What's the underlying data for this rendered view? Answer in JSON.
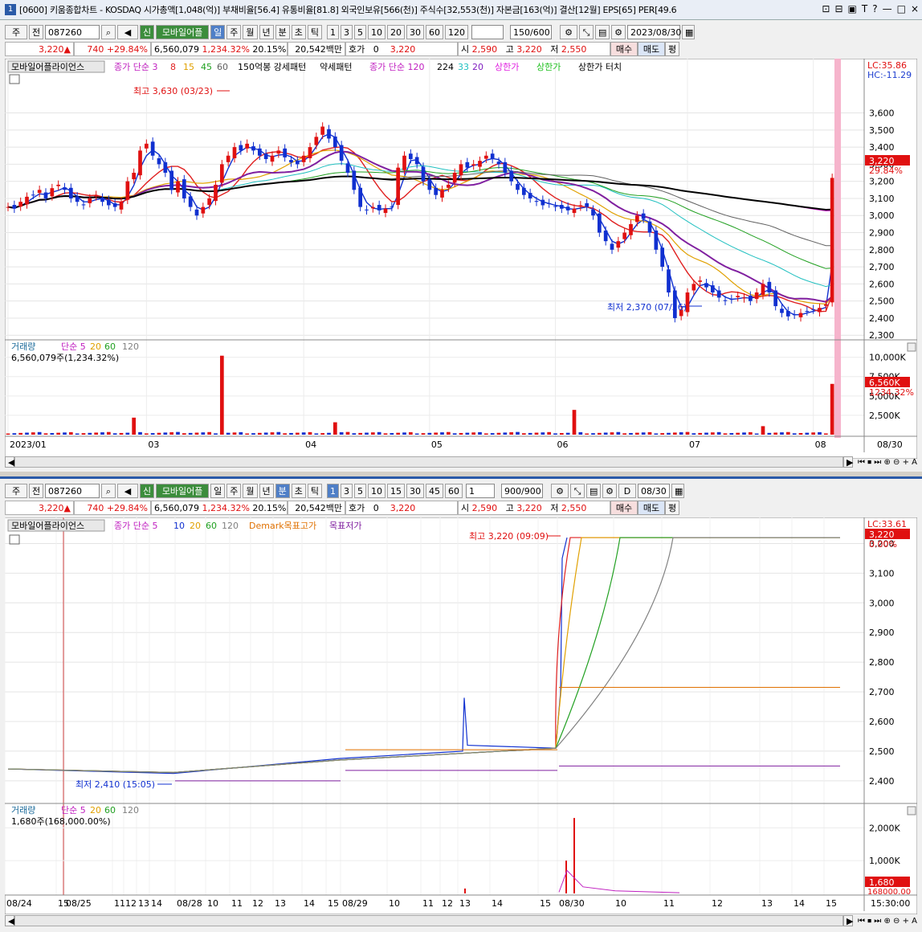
{
  "window": {
    "num": "1",
    "title": "[0600] 키움종합차트 - KOSDAQ 시가총액[1,048(억)] 부채비율[56.4] 유통비율[81.8] 외국인보유[566(천)] 주식수[32,553(천)] 자본금[163(억)] 결산[12월] EPS[65] PER[49.6",
    "controls": [
      "⊡",
      "⊟",
      "▣",
      "T",
      "?",
      "—",
      "□",
      "×"
    ]
  },
  "top": {
    "toolbar": {
      "market": "주",
      "prev": "전",
      "code": "087260",
      "name_badge": "신",
      "name": "모바일어플",
      "periods": [
        "일",
        "주",
        "월",
        "년",
        "분",
        "초",
        "틱"
      ],
      "selected_period": "일",
      "nums": [
        "1",
        "3",
        "5",
        "10",
        "20",
        "30",
        "60",
        "120"
      ],
      "count": "150",
      "count_total": "/600",
      "date": "2023/08/30"
    },
    "quote": {
      "price": "3,220",
      "arrow": "▲",
      "change": "740",
      "pct": "+29.84%",
      "volume": "6,560,079",
      "vol_pct": "1,234.32%",
      "turnover": "20.15%",
      "amount": "20,542백만",
      "hoga_label": "호가",
      "hoga_val": "0",
      "hoga_price": "3,220",
      "open_label": "시",
      "open": "2,590",
      "high_label": "고",
      "high": "3,220",
      "low_label": "저",
      "low": "2,550",
      "buy": "매수",
      "sell": "매도",
      "flat": "평"
    },
    "legend": {
      "name": "모바일어플라이언스",
      "ma_label": "종가 단순 3",
      "ma_periods": [
        "8",
        "15",
        "45",
        "60"
      ],
      "ind1": "150억봉 강세패턴",
      "ind2": "약세패턴",
      "ma2_label": "종가 단순 120",
      "ma2_periods": [
        "224",
        "33",
        "20"
      ],
      "upper1": "상한가",
      "upper2": "상한가",
      "upper3": "상한가 터치"
    },
    "lc": "LC:35.86",
    "hc": "HC:-11.29",
    "price_tag": "3,220",
    "price_tag_pct": "29.84%",
    "high_note": "최고 3,630 (03/23)",
    "low_note": "최저 2,370 (07/26)",
    "vol_legend_name": "거래량",
    "vol_legend_ma": "단순 5",
    "vol_legend_p": [
      "20",
      "60",
      "120"
    ],
    "vol_text": "6,560,079주(1,234.32%)",
    "vol_tag": "6,560K",
    "vol_tag_pct": "1234.32%",
    "x_labels": [
      "2023/01",
      "03",
      "04",
      "05",
      "06",
      "07",
      "08"
    ],
    "x_right": "08/30"
  },
  "bottom": {
    "toolbar": {
      "market": "주",
      "prev": "전",
      "code": "087260",
      "name_badge": "신",
      "name": "모바일어플",
      "periods": [
        "일",
        "주",
        "월",
        "년",
        "분",
        "초",
        "틱"
      ],
      "selected_period": "분",
      "nums": [
        "1",
        "3",
        "5",
        "10",
        "15",
        "30",
        "45",
        "60"
      ],
      "sel_num": "1",
      "count": "900",
      "count_total": "/900",
      "date": "08/30",
      "d_label": "D"
    },
    "quote": {
      "price": "3,220",
      "arrow": "▲",
      "change": "740",
      "pct": "+29.84%",
      "volume": "6,560,079",
      "vol_pct": "1,234.32%",
      "turnover": "20.15%",
      "amount": "20,542백만",
      "hoga_label": "호가",
      "hoga_val": "0",
      "hoga_price": "3,220",
      "open_label": "시",
      "open": "2,590",
      "high_label": "고",
      "high": "3,220",
      "low_label": "저",
      "low": "2,550",
      "buy": "매수",
      "sell": "매도",
      "flat": "평"
    },
    "legend": {
      "name": "모바일어플라이언스",
      "ma_label": "종가 단순 5",
      "ma_periods": [
        "10",
        "20",
        "60",
        "120"
      ],
      "demark_hi": "Demark목표고가",
      "demark_lo": "목표저가"
    },
    "lc": "LC:33.61",
    "price_tag": "3,220",
    "price_tag_pct": "0.00%",
    "high_note": "최고 3,220 (09:09)",
    "low_note": "최저 2,410 (15:05)",
    "vol_legend_name": "거래량",
    "vol_legend_ma": "단순 5",
    "vol_legend_p": [
      "20",
      "60",
      "120"
    ],
    "vol_text": "1,680주(168,000.00%)",
    "vol_tag": "1,680",
    "vol_tag_pct": "168000.00",
    "x_labels": [
      "08/24",
      "15",
      "08/25",
      "11",
      "12",
      "13",
      "14",
      "08/28",
      "10",
      "11",
      "12",
      "13",
      "14",
      "15",
      "08/29",
      "10",
      "11",
      "12",
      "13",
      "14",
      "15",
      "08/30",
      "10",
      "11",
      "12",
      "13",
      "14",
      "15"
    ],
    "x_right": "15:30:00"
  },
  "chart_data": [
    {
      "type": "candlestick",
      "title": "모바일어플라이언스 일봉",
      "y_ticks": [
        2300,
        2400,
        2500,
        2600,
        2700,
        2800,
        2900,
        3000,
        3100,
        3200,
        3300,
        3400,
        3500,
        3600
      ],
      "ylim": [
        2240,
        3720
      ],
      "x_months": [
        "2023/01",
        "03",
        "04",
        "05",
        "06",
        "07",
        "08"
      ],
      "close_series": [
        3050,
        3040,
        3080,
        3110,
        3120,
        3150,
        3100,
        3160,
        3180,
        3150,
        3100,
        3080,
        3060,
        3100,
        3120,
        3080,
        3060,
        3050,
        3080,
        3200,
        3250,
        3380,
        3420,
        3350,
        3300,
        3250,
        3150,
        3200,
        3100,
        3050,
        3000,
        3050,
        3100,
        3180,
        3300,
        3350,
        3400,
        3380,
        3420,
        3380,
        3350,
        3330,
        3350,
        3380,
        3340,
        3310,
        3300,
        3350,
        3400,
        3460,
        3520,
        3450,
        3400,
        3320,
        3250,
        3150,
        3050,
        3030,
        3050,
        3030,
        3040,
        3050,
        3280,
        3350,
        3330,
        3300,
        3200,
        3150,
        3120,
        3150,
        3180,
        3250,
        3300,
        3280,
        3300,
        3320,
        3350,
        3330,
        3300,
        3250,
        3200,
        3150,
        3120,
        3100,
        3080,
        3060,
        3070,
        3050,
        3040,
        3030,
        3040,
        3060,
        3050,
        3000,
        2900,
        2850,
        2800,
        2850,
        2900,
        2950,
        3000,
        2980,
        2900,
        2800,
        2700,
        2550,
        2400,
        2450,
        2550,
        2600,
        2620,
        2580,
        2550,
        2520,
        2500,
        2510,
        2530,
        2520,
        2500,
        2550,
        2600,
        2550,
        2470,
        2430,
        2410,
        2420,
        2430,
        2440,
        2450,
        2460,
        2480,
        3220
      ],
      "high_label": "최고 3,630 (03/23)",
      "low_label": "최저 2,370 (07/26)",
      "last": 3220
    },
    {
      "type": "bar",
      "title": "거래량",
      "y_ticks": [
        2500,
        5000,
        7500,
        10000
      ],
      "unit": "K",
      "spikes": [
        {
          "i": 34,
          "v": 10200
        },
        {
          "i": 20,
          "v": 2200
        },
        {
          "i": 52,
          "v": 1600
        },
        {
          "i": 90,
          "v": 3200
        },
        {
          "i": 120,
          "v": 1100
        },
        {
          "i": 131,
          "v": 6560
        }
      ]
    },
    {
      "type": "line",
      "title": "모바일어플라이언스 1분봉",
      "y_ticks": [
        2400,
        2500,
        2600,
        2700,
        2800,
        2900,
        3000,
        3100,
        3200
      ],
      "ylim": [
        2340,
        3250
      ],
      "segments": [
        {
          "day": "08/24-25",
          "from": 2440,
          "to": 2425
        },
        {
          "day": "08/28",
          "from": 2420,
          "to": 2475
        },
        {
          "day": "08/29",
          "from": 2475,
          "to": 2510
        },
        {
          "day": "08/30",
          "from": 2510,
          "to": 3220
        }
      ],
      "high_label": "최고 3,220 (09:09)",
      "low_label": "최저 2,410 (15:05)",
      "demark_hi": 2715,
      "demark_lo": 2450
    },
    {
      "type": "bar",
      "title": "거래량",
      "y_ticks": [
        1000,
        2000
      ],
      "unit": "K",
      "spikes": [
        {
          "t": "08/30 09:09",
          "v": 2300
        },
        {
          "t": "08/30 09:05",
          "v": 1000
        },
        {
          "t": "08/29 13:10",
          "v": 150
        }
      ]
    }
  ]
}
